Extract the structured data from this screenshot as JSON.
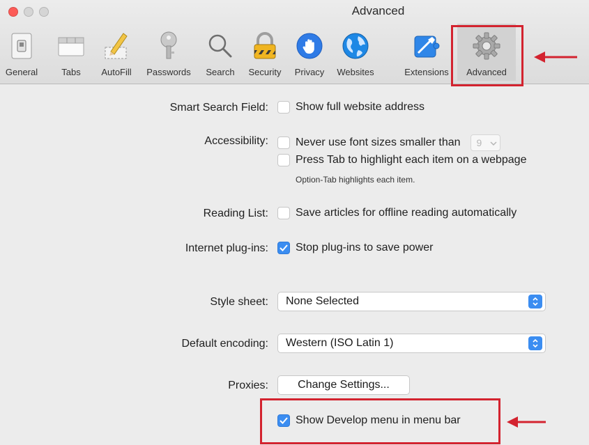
{
  "window": {
    "title": "Advanced"
  },
  "toolbar": {
    "items": [
      {
        "label": "General",
        "icon": "switch-icon"
      },
      {
        "label": "Tabs",
        "icon": "tabs-icon"
      },
      {
        "label": "AutoFill",
        "icon": "pencil-icon"
      },
      {
        "label": "Passwords",
        "icon": "key-icon"
      },
      {
        "label": "Search",
        "icon": "magnifier-icon"
      },
      {
        "label": "Security",
        "icon": "lock-icon"
      },
      {
        "label": "Privacy",
        "icon": "hand-icon"
      },
      {
        "label": "Websites",
        "icon": "globe-icon"
      },
      {
        "label": "Extensions",
        "icon": "puzzle-icon"
      },
      {
        "label": "Advanced",
        "icon": "gear-icon",
        "selected": true
      }
    ]
  },
  "settings": {
    "smart_search": {
      "label": "Smart Search Field:",
      "option": "Show full website address",
      "checked": false
    },
    "accessibility": {
      "label": "Accessibility:",
      "option1": "Never use font sizes smaller than",
      "font_size": "9",
      "option2": "Press Tab to highlight each item on a webpage",
      "hint": "Option-Tab highlights each item."
    },
    "reading_list": {
      "label": "Reading List:",
      "option": "Save articles for offline reading automatically",
      "checked": false
    },
    "plugins": {
      "label": "Internet plug-ins:",
      "option": "Stop plug-ins to save power",
      "checked": true
    },
    "style_sheet": {
      "label": "Style sheet:",
      "value": "None Selected"
    },
    "encoding": {
      "label": "Default encoding:",
      "value": "Western (ISO Latin 1)"
    },
    "proxies": {
      "label": "Proxies:",
      "button": "Change Settings..."
    },
    "develop": {
      "option": "Show Develop menu in menu bar",
      "checked": true
    }
  },
  "colors": {
    "accent": "#3b8df1",
    "highlight": "#d3232f"
  }
}
